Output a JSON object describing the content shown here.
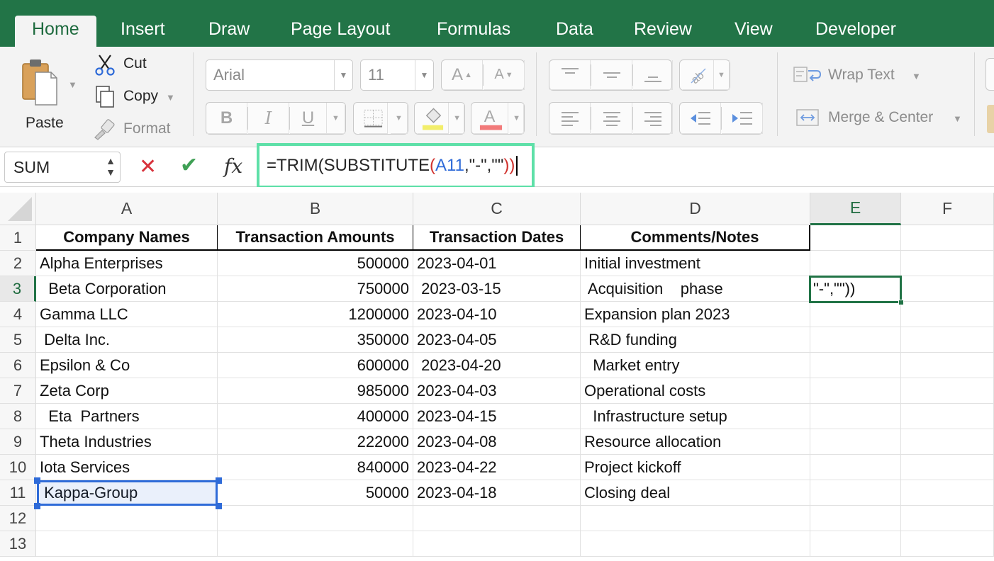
{
  "tabs": [
    "Home",
    "Insert",
    "Draw",
    "Page Layout",
    "Formulas",
    "Data",
    "Review",
    "View",
    "Developer"
  ],
  "active_tab": "Home",
  "ribbon": {
    "paste_label": "Paste",
    "cut_label": "Cut",
    "copy_label": "Copy",
    "format_label": "Format",
    "font_name": "Arial",
    "font_size": "11",
    "wrap_text_label": "Wrap Text",
    "merge_center_label": "Merge & Center"
  },
  "formula_bar": {
    "name_box": "SUM",
    "formula_prefix": "=TRIM(SUBSTITUTE",
    "formula_open": "(",
    "formula_ref": "A11",
    "formula_args": ",\"-\",\"\"",
    "formula_close": "))"
  },
  "columns": [
    "A",
    "B",
    "C",
    "D",
    "E",
    "F"
  ],
  "selected_column": "E",
  "rows": [
    1,
    2,
    3,
    4,
    5,
    6,
    7,
    8,
    9,
    10,
    11,
    12,
    13
  ],
  "selected_row": 3,
  "headers": [
    "Company Names",
    "Transaction Amounts",
    "Transaction Dates",
    "Comments/Notes"
  ],
  "data_rows": [
    [
      "Alpha Enterprises",
      "500000",
      "2023-04-01",
      "Initial investment"
    ],
    [
      "  Beta Corporation",
      "750000",
      " 2023-03-15",
      " Acquisition    phase"
    ],
    [
      "Gamma LLC",
      "1200000",
      "2023-04-10",
      "Expansion plan 2023"
    ],
    [
      " Delta Inc.",
      "350000",
      "2023-04-05",
      " R&D funding"
    ],
    [
      "Epsilon & Co",
      "600000",
      " 2023-04-20",
      "  Market entry"
    ],
    [
      "Zeta Corp",
      "985000",
      "2023-04-03",
      "Operational costs"
    ],
    [
      "  Eta  Partners",
      "400000",
      "2023-04-15",
      "  Infrastructure setup"
    ],
    [
      "Theta Industries",
      "222000",
      "2023-04-08",
      "Resource allocation"
    ],
    [
      "Iota Services",
      "840000",
      "2023-04-22",
      "Project kickoff"
    ],
    [
      " Kappa-Group",
      "50000",
      "2023-04-18",
      "Closing deal"
    ]
  ],
  "e3_overflow_text": "\"-\",\"\"))",
  "colors": {
    "tab_bar": "#227447",
    "selection_blue": "#2f6bd8",
    "formula_highlight": "#5ee0a8",
    "active_cell_green": "#217346"
  }
}
